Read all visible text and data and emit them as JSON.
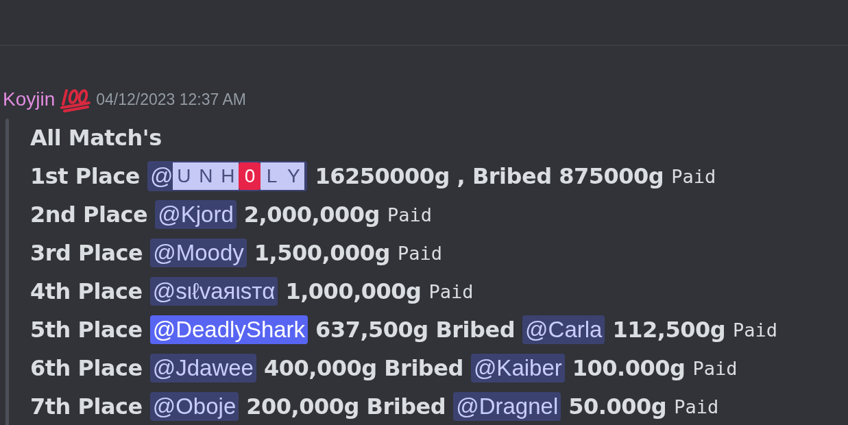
{
  "message": {
    "author": "Koyjin",
    "timestamp": "04/12/2023 12:37 AM",
    "lines": [
      {
        "parts": [
          {
            "kind": "text",
            "text": "All Match's"
          }
        ]
      },
      {
        "parts": [
          {
            "kind": "text",
            "text": "1st Place"
          },
          {
            "kind": "tiled_mention",
            "at": "@",
            "tiles": [
              {
                "text": "U",
                "kind": "light"
              },
              {
                "text": "N",
                "kind": "light"
              },
              {
                "text": "H",
                "kind": "light"
              },
              {
                "text": "0",
                "kind": "red"
              },
              {
                "text": "L",
                "kind": "light"
              },
              {
                "text": "Y",
                "kind": "light"
              }
            ]
          },
          {
            "kind": "text",
            "text": "16250000g , Bribed 875000g"
          },
          {
            "kind": "code",
            "text": "Paid"
          }
        ]
      },
      {
        "parts": [
          {
            "kind": "text",
            "text": "2nd Place"
          },
          {
            "kind": "mention",
            "text": "@Kjord",
            "highlighted": false
          },
          {
            "kind": "text",
            "text": "2,000,000g"
          },
          {
            "kind": "code",
            "text": "Paid"
          }
        ]
      },
      {
        "parts": [
          {
            "kind": "text",
            "text": "3rd Place"
          },
          {
            "kind": "mention",
            "text": "@Moody",
            "highlighted": false
          },
          {
            "kind": "text",
            "text": "1,500,000g"
          },
          {
            "kind": "code",
            "text": "Paid"
          }
        ]
      },
      {
        "parts": [
          {
            "kind": "text",
            "text": "4th Place"
          },
          {
            "kind": "mention",
            "text": "@sιℓvaяιsтα",
            "highlighted": false
          },
          {
            "kind": "text",
            "text": "1,000,000g"
          },
          {
            "kind": "code",
            "text": "Paid"
          }
        ]
      },
      {
        "parts": [
          {
            "kind": "text",
            "text": "5th Place"
          },
          {
            "kind": "mention",
            "text": "@DeadlyShark",
            "highlighted": true
          },
          {
            "kind": "text",
            "text": "637,500g Bribed"
          },
          {
            "kind": "mention",
            "text": "@Carla",
            "highlighted": false
          },
          {
            "kind": "text",
            "text": "112,500g"
          },
          {
            "kind": "code",
            "text": "Paid"
          }
        ]
      },
      {
        "parts": [
          {
            "kind": "text",
            "text": "6th Place"
          },
          {
            "kind": "mention",
            "text": "@Jdawee",
            "highlighted": false
          },
          {
            "kind": "text",
            "text": "400,000g Bribed"
          },
          {
            "kind": "mention",
            "text": "@Kaiber",
            "highlighted": false
          },
          {
            "kind": "text",
            "text": "100.000g"
          },
          {
            "kind": "code",
            "text": "Paid"
          }
        ]
      },
      {
        "parts": [
          {
            "kind": "text",
            "text": "7th Place"
          },
          {
            "kind": "mention",
            "text": "@Oboje",
            "highlighted": false
          },
          {
            "kind": "text",
            "text": "200,000g Bribed"
          },
          {
            "kind": "mention",
            "text": "@Dragnel",
            "highlighted": false
          },
          {
            "kind": "text",
            "text": "50.000g"
          },
          {
            "kind": "code",
            "text": "Paid"
          }
        ]
      }
    ]
  }
}
